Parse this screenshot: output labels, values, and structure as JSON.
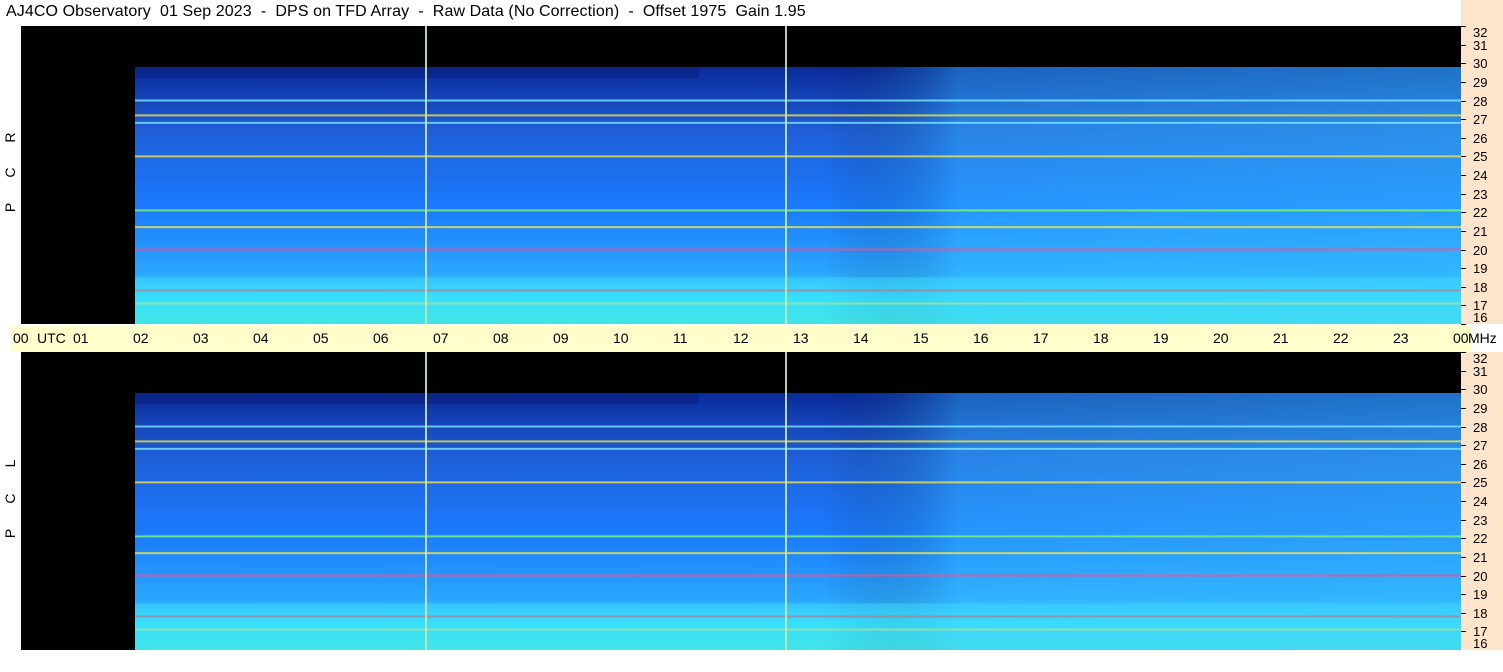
{
  "title": "AJ4CO Observatory  01 Sep 2023  -  DPS on TFD Array  -  Raw Data (No Correction)  -  Offset 1975  Gain 1.95",
  "colors": {
    "background": "#000000",
    "low": "#0a2a9a",
    "mid": "#1a7bff",
    "high": "#2ee8ff",
    "peak": "#ffe93a",
    "hot": "#ff3a3a",
    "time_axis_bg": "#ffffcc",
    "freq_axis_bg": "#ffe4cc"
  },
  "chart_data": [
    {
      "type": "heatmap",
      "channel": "R C P",
      "x_axis": {
        "ticks": [
          "00",
          "01",
          "02",
          "03",
          "04",
          "05",
          "06",
          "07",
          "08",
          "09",
          "10",
          "11",
          "12",
          "13",
          "14",
          "15",
          "16",
          "17",
          "18",
          "19",
          "20",
          "21",
          "22",
          "23",
          "00"
        ],
        "unit_label": "UTC",
        "range": [
          0,
          24
        ]
      },
      "y_axis": {
        "ticks": [
          32,
          31,
          30,
          29,
          28,
          27,
          26,
          25,
          24,
          23,
          22,
          21,
          20,
          19,
          18,
          17,
          16
        ],
        "unit_label": "MHz",
        "range": [
          16,
          32
        ]
      },
      "data_start_utc": 1.9,
      "noise_floor_upper_edge_mhz": 29.8,
      "vertical_marker_lines_utc": [
        6.75,
        12.75
      ],
      "persistent_horizontal_signals_mhz": [
        17.1,
        17.8,
        20.0,
        21.2,
        22.1,
        25.0,
        26.8,
        27.2,
        28.0
      ]
    },
    {
      "type": "heatmap",
      "channel": "L C P",
      "x_axis": {
        "ticks": [
          "00",
          "01",
          "02",
          "03",
          "04",
          "05",
          "06",
          "07",
          "08",
          "09",
          "10",
          "11",
          "12",
          "13",
          "14",
          "15",
          "16",
          "17",
          "18",
          "19",
          "20",
          "21",
          "22",
          "23",
          "00"
        ],
        "unit_label": "UTC",
        "range": [
          0,
          24
        ]
      },
      "y_axis": {
        "ticks": [
          32,
          31,
          30,
          29,
          28,
          27,
          26,
          25,
          24,
          23,
          22,
          21,
          20,
          19,
          18,
          17,
          16
        ],
        "unit_label": "MHz",
        "range": [
          16,
          32
        ]
      },
      "data_start_utc": 1.9,
      "noise_floor_upper_edge_mhz": 29.8,
      "vertical_marker_lines_utc": [
        6.75,
        12.75
      ],
      "persistent_horizontal_signals_mhz": [
        17.1,
        17.8,
        20.0,
        21.2,
        22.1,
        25.0,
        26.8,
        27.2,
        28.0
      ]
    }
  ]
}
